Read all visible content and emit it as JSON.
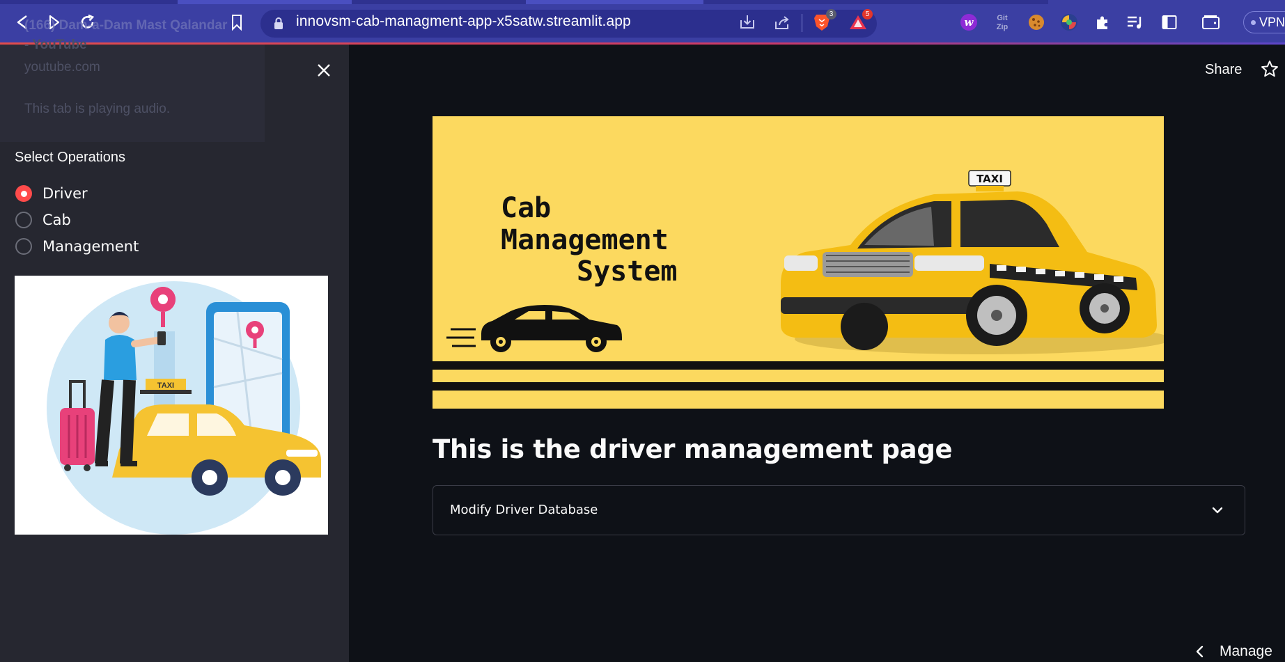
{
  "browser": {
    "url": "innovsm-cab-managment-app-x5satw.streamlit.app",
    "brave_badge_count": "3",
    "rewards_badge_count": "5",
    "vpn_label": "VPN",
    "ext_gitzip_label": "Git Zip",
    "ext_w_label": "w"
  },
  "tab_tooltip": {
    "title": "(166) Dam-a-Dam Mast Qalandar",
    "subtitle": "- YouTube",
    "domain": "youtube.com",
    "audio_note": "This tab is playing audio."
  },
  "sidebar": {
    "radio_label": "Select Operations",
    "options": [
      {
        "label": "Driver",
        "selected": true
      },
      {
        "label": "Cab",
        "selected": false
      },
      {
        "label": "Management",
        "selected": false
      }
    ],
    "illustration": {
      "sign_text": "TAXI"
    }
  },
  "header": {
    "share_label": "Share"
  },
  "banner": {
    "line1": "Cab",
    "line2": "Management",
    "line3": "System",
    "roof_sign": "TAXI"
  },
  "main": {
    "title": "This is the driver management page",
    "expander_label": "Modify Driver Database"
  },
  "footer": {
    "manage_label": "Manage"
  },
  "colors": {
    "accent": "#ff4b4b",
    "banner_yellow": "#fcd95f",
    "chrome_blue": "#3b3fa3"
  }
}
